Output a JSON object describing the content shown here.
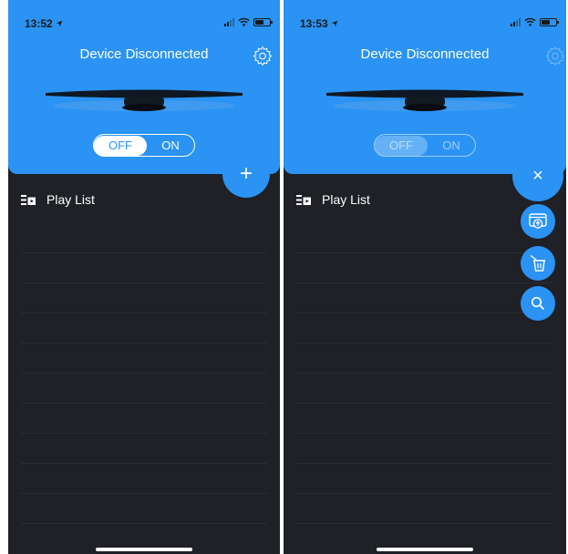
{
  "left": {
    "status": {
      "time": "13:52"
    },
    "header": {
      "title": "Device Disconnected",
      "toggle_off": "OFF",
      "toggle_on": "ON"
    },
    "playlist": {
      "label": "Play List"
    },
    "fab": {
      "label": "+"
    }
  },
  "right": {
    "status": {
      "time": "13:53"
    },
    "header": {
      "title": "Device Disconnected",
      "toggle_off": "OFF",
      "toggle_on": "ON"
    },
    "playlist": {
      "label": "Play List"
    },
    "fab": {
      "close_label": "×"
    },
    "fab_menu": {
      "upload": "upload-icon",
      "clear": "clear-list-icon",
      "search": "search-icon"
    }
  },
  "colors": {
    "accent": "#2a93f3",
    "background": "#1f2127"
  },
  "icons": {
    "settings": "gear-icon",
    "playlist": "playlist-icon",
    "location": "location-arrow-icon",
    "wifi": "wifi-icon",
    "battery": "battery-icon",
    "signal": "signal-icon"
  }
}
